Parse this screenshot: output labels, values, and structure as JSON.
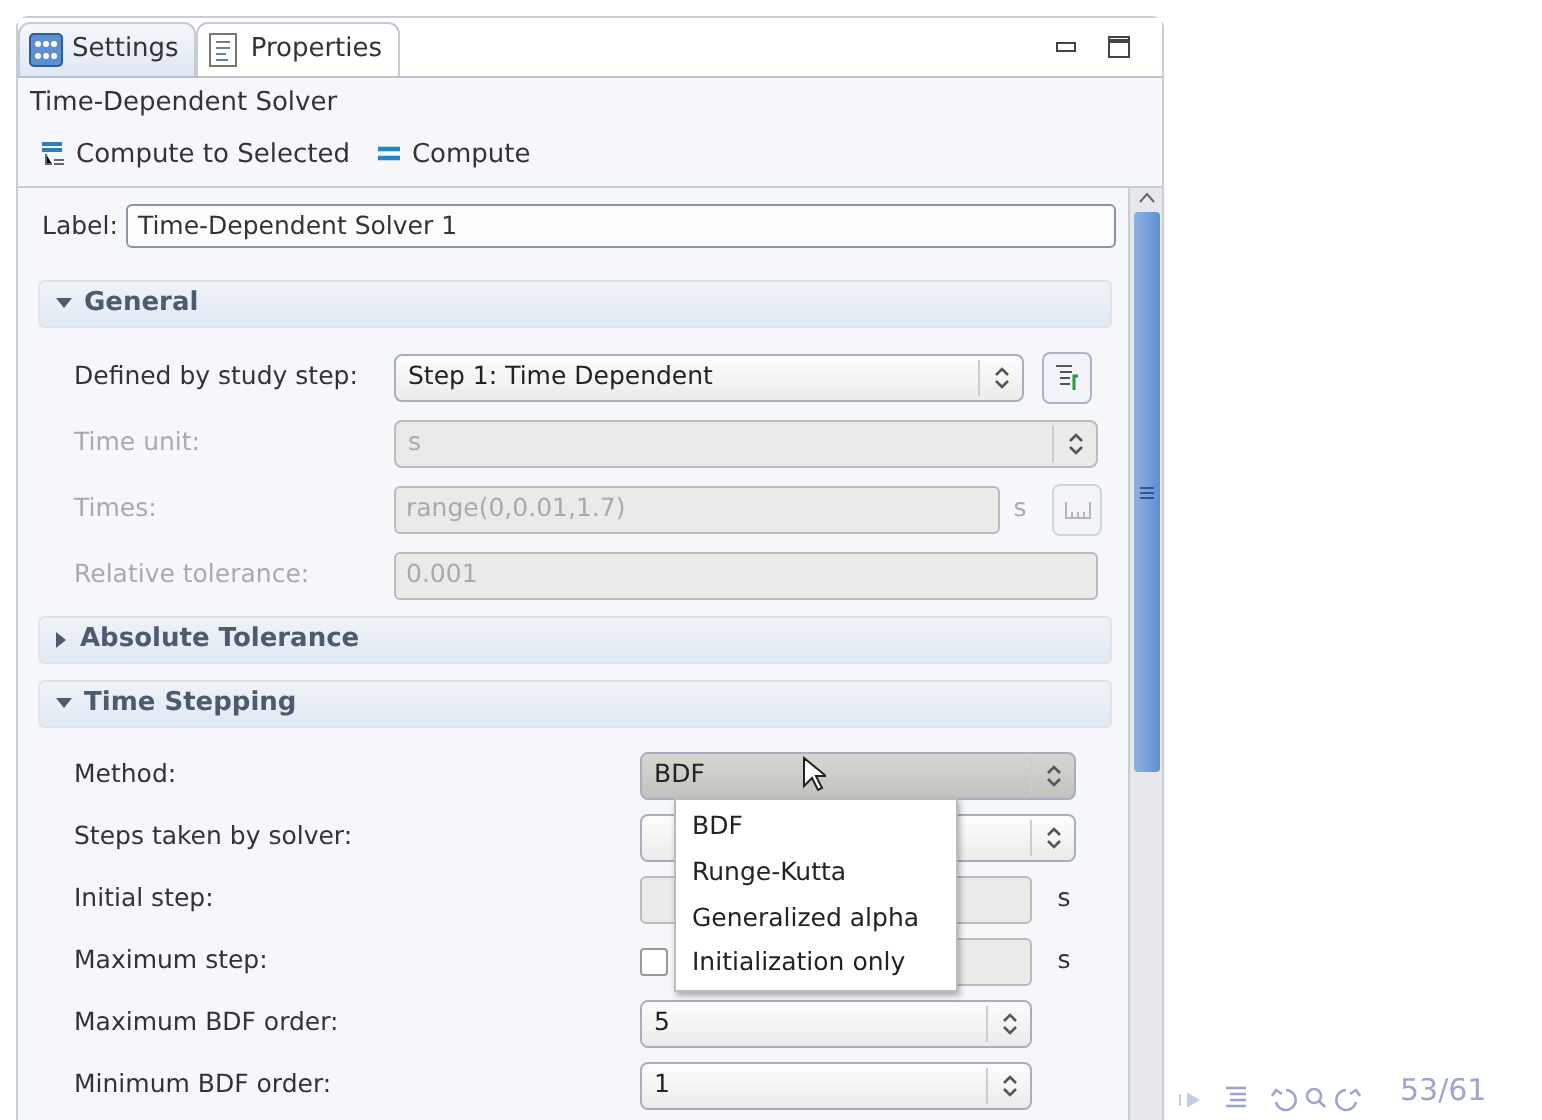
{
  "tabs": [
    {
      "label": "Settings",
      "selected": true
    },
    {
      "label": "Properties",
      "selected": false
    }
  ],
  "title": "Time-Dependent Solver",
  "toolbar": [
    {
      "label": "Compute to Selected",
      "kind": "selected"
    },
    {
      "label": "Compute",
      "kind": "all"
    }
  ],
  "label_field": {
    "label": "Label:",
    "value": "Time-Dependent Solver 1"
  },
  "sections": [
    {
      "title": "General",
      "expanded": true,
      "rows": [
        {
          "kind": "combo",
          "label": "Defined by study step:",
          "value": "Step 1: Time Dependent",
          "disabled": false,
          "button": true
        },
        {
          "kind": "combo",
          "label": "Time unit:",
          "value": "s",
          "disabled": true,
          "button": false
        },
        {
          "kind": "field",
          "label": "Times:",
          "value": "range(0,0.01,1.7)",
          "unit": "s",
          "disabled": true,
          "button": true
        },
        {
          "kind": "field",
          "label": "Relative tolerance:",
          "value": "0.001",
          "disabled": true,
          "button": false
        }
      ]
    },
    {
      "title": "Absolute Tolerance",
      "expanded": false
    },
    {
      "title": "Time Stepping",
      "expanded": true,
      "rows": [
        {
          "kind": "combo",
          "label": "Method:",
          "value": "BDF",
          "disabled": false,
          "open": true,
          "options": [
            {
              "label": "BDF"
            },
            {
              "label": "Runge-Kutta"
            },
            {
              "label": "Generalized alpha"
            },
            {
              "label": "Initialization only"
            }
          ]
        },
        {
          "kind": "combo",
          "label": "Steps taken by solver:",
          "disabled": false,
          "open": false
        },
        {
          "kind": "field",
          "label": "Initial step:",
          "unit": "s",
          "disabled": true
        },
        {
          "kind": "checkfield",
          "label": "Maximum step:",
          "unit": "s",
          "disabled": true,
          "checked": false
        },
        {
          "kind": "combo",
          "label": "Maximum BDF order:",
          "value": "5",
          "disabled": false,
          "open": false,
          "narrow": true
        },
        {
          "kind": "combo",
          "label": "Minimum BDF order:",
          "value": "1",
          "disabled": false,
          "open": false,
          "narrow": true
        }
      ]
    }
  ],
  "footer": {
    "page": "53/61"
  }
}
